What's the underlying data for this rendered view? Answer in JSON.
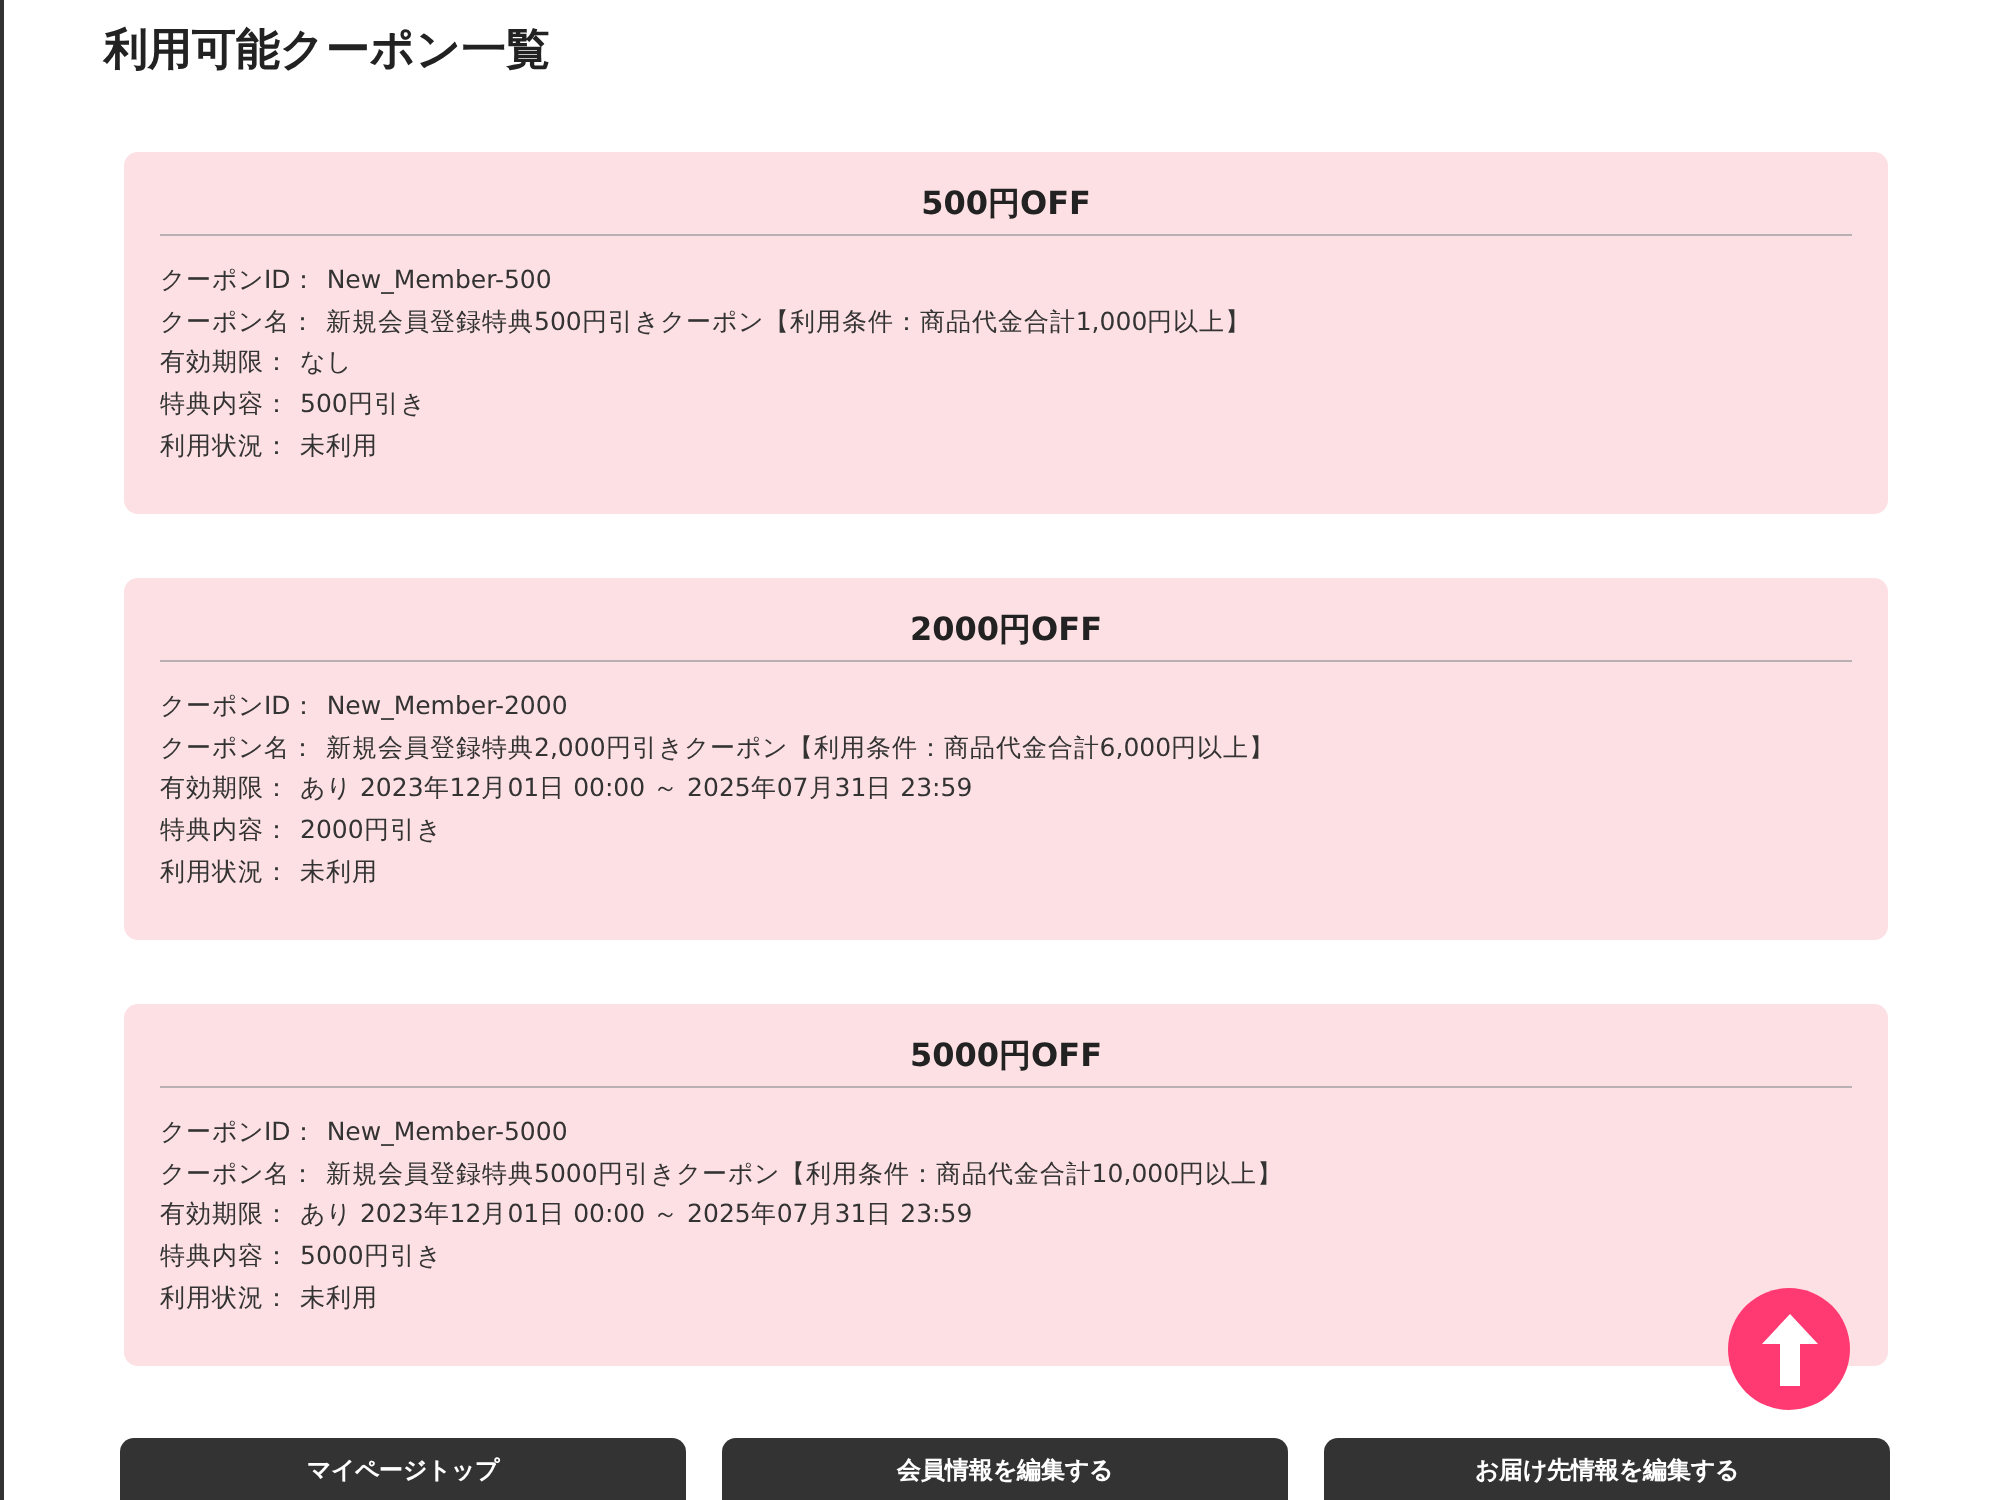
{
  "heading": "利用可能クーポン一覧",
  "coupons": [
    {
      "title": "500円OFF",
      "fields": [
        {
          "label": "クーポンID：",
          "value": "New_Member-500"
        },
        {
          "label": "クーポン名：",
          "value": "新規会員登録特典500円引きクーポン【利用条件：商品代金合計1,000円以上】"
        },
        {
          "label": "有効期限：",
          "value": "なし"
        },
        {
          "label": "特典内容：",
          "value": "500円引き"
        },
        {
          "label": "利用状況：",
          "value": "未利用"
        }
      ]
    },
    {
      "title": "2000円OFF",
      "fields": [
        {
          "label": "クーポンID：",
          "value": "New_Member-2000"
        },
        {
          "label": "クーポン名：",
          "value": "新規会員登録特典2,000円引きクーポン【利用条件：商品代金合計6,000円以上】"
        },
        {
          "label": "有効期限：",
          "value": "あり 2023年12月01日 00:00 ～ 2025年07月31日 23:59"
        },
        {
          "label": "特典内容：",
          "value": "2000円引き"
        },
        {
          "label": "利用状況：",
          "value": "未利用"
        }
      ]
    },
    {
      "title": "5000円OFF",
      "fields": [
        {
          "label": "クーポンID：",
          "value": "New_Member-5000"
        },
        {
          "label": "クーポン名：",
          "value": "新規会員登録特典5000円引きクーポン【利用条件：商品代金合計10,000円以上】"
        },
        {
          "label": "有効期限：",
          "value": "あり 2023年12月01日 00:00 ～ 2025年07月31日 23:59"
        },
        {
          "label": "特典内容：",
          "value": "5000円引き"
        },
        {
          "label": "利用状況：",
          "value": "未利用"
        }
      ]
    }
  ],
  "buttons": [
    "マイページトップ",
    "会員情報を編集する",
    "お届け先情報を編集する"
  ]
}
